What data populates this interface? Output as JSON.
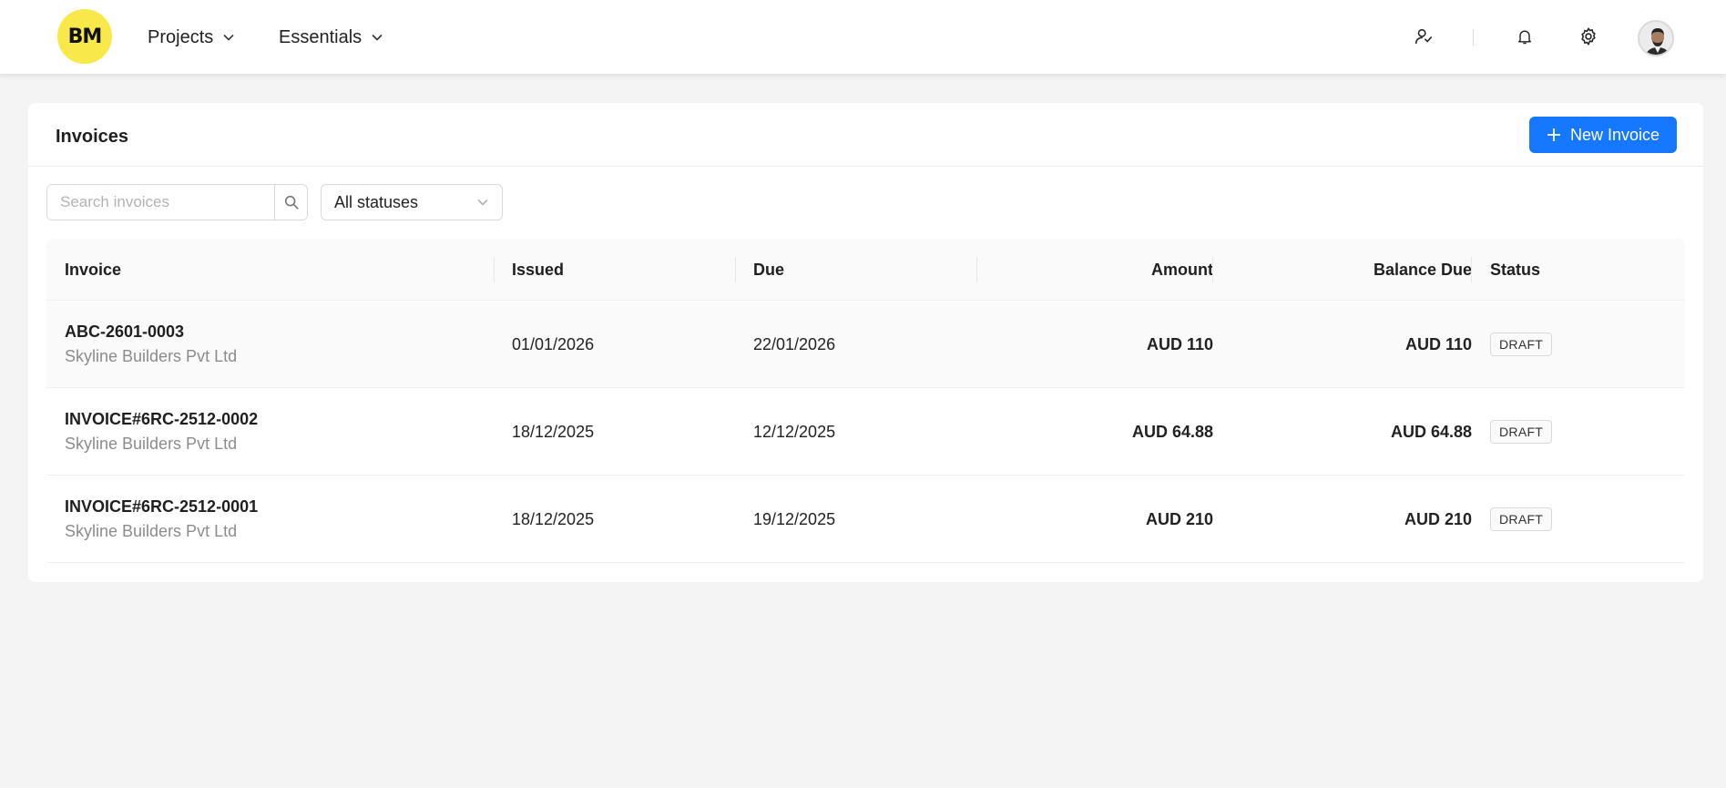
{
  "header": {
    "logo_text": "BM",
    "nav": [
      {
        "label": "Projects"
      },
      {
        "label": "Essentials"
      }
    ],
    "icons": [
      "contacts-icon",
      "bell-icon",
      "gear-icon"
    ]
  },
  "invoices": {
    "title": "Invoices",
    "new_button_label": "New Invoice",
    "search_placeholder": "Search invoices",
    "status_filter": "All statuses",
    "columns": [
      "Invoice",
      "Issued",
      "Due",
      "Amount",
      "Balance Due",
      "Status"
    ],
    "rows": [
      {
        "number": "ABC-2601-0003",
        "client": "Skyline Builders Pvt Ltd",
        "issued": "01/01/2026",
        "due": "22/01/2026",
        "amount": "AUD 110",
        "balance": "AUD 110",
        "status": "DRAFT"
      },
      {
        "number": "INVOICE#6RC-2512-0002",
        "client": "Skyline Builders Pvt Ltd",
        "issued": "18/12/2025",
        "due": "12/12/2025",
        "amount": "AUD 64.88",
        "balance": "AUD 64.88",
        "status": "DRAFT"
      },
      {
        "number": "INVOICE#6RC-2512-0001",
        "client": "Skyline Builders Pvt Ltd",
        "issued": "18/12/2025",
        "due": "19/12/2025",
        "amount": "AUD 210",
        "balance": "AUD 210",
        "status": "DRAFT"
      }
    ]
  },
  "colors": {
    "primary": "#1677ff",
    "logo_bg": "#f8e84a",
    "page_bg": "#f4f4f4"
  }
}
